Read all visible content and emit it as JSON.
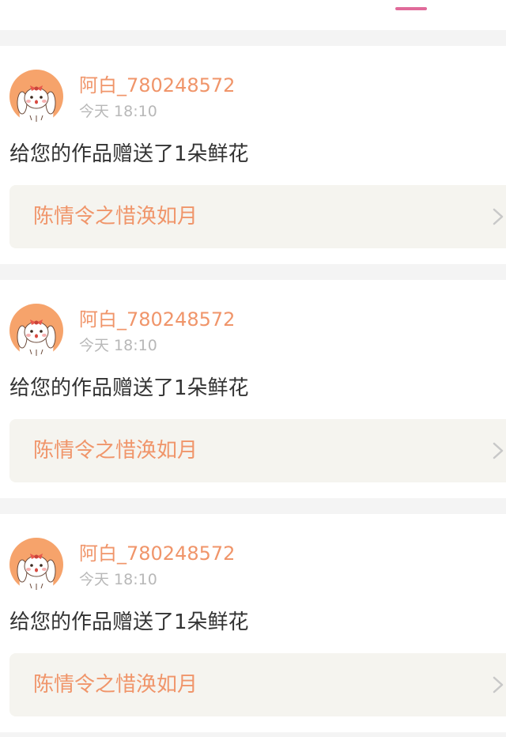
{
  "header": {
    "active_tab_color": "#e06a9a"
  },
  "notifications": [
    {
      "username": "阿白_780248572",
      "time": "今天 18:10",
      "message": "给您的作品赠送了1朵鲜花",
      "work_title": "陈情令之惜涣如月",
      "avatar_icon": "bunny-avatar-icon",
      "link_icon": "chevron-right-icon"
    },
    {
      "username": "阿白_780248572",
      "time": "今天 18:10",
      "message": "给您的作品赠送了1朵鲜花",
      "work_title": "陈情令之惜涣如月",
      "avatar_icon": "bunny-avatar-icon",
      "link_icon": "chevron-right-icon"
    },
    {
      "username": "阿白_780248572",
      "time": "今天 18:10",
      "message": "给您的作品赠送了1朵鲜花",
      "work_title": "陈情令之惜涣如月",
      "avatar_icon": "bunny-avatar-icon",
      "link_icon": "chevron-right-icon"
    }
  ],
  "colors": {
    "accent": "#f0956a",
    "muted_text": "#b8b8b8",
    "body_text": "#333333",
    "link_background": "#f5f4ef",
    "page_background": "#f4f4f4"
  }
}
